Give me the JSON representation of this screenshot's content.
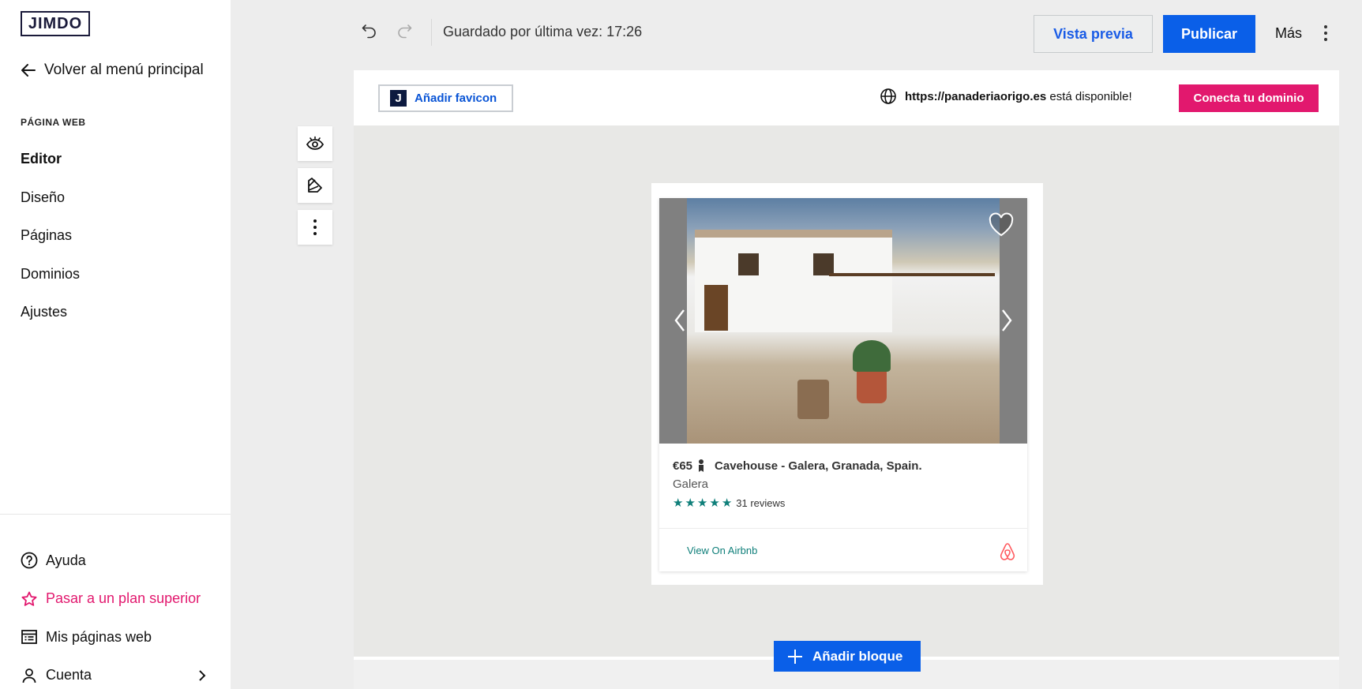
{
  "brand": {
    "logo_text": "JIMDO"
  },
  "sidebar": {
    "back_label": "Volver al menú principal",
    "section_label": "PÁGINA WEB",
    "items": [
      {
        "label": "Editor",
        "active": true
      },
      {
        "label": "Diseño"
      },
      {
        "label": "Páginas"
      },
      {
        "label": "Dominios"
      },
      {
        "label": "Ajustes"
      }
    ],
    "bottom": {
      "help": "Ayuda",
      "upgrade": "Pasar a un plan superior",
      "my_sites": "Mis páginas web",
      "account": "Cuenta"
    }
  },
  "toolbar": {
    "saved_text": "Guardado por última vez: 17:26",
    "preview_label": "Vista previa",
    "publish_label": "Publicar",
    "more_label": "Más"
  },
  "site_header": {
    "favicon_letter": "J",
    "favicon_label": "Añadir favicon",
    "domain_url": "https://panaderiaorigo.es",
    "domain_suffix": " está disponible!",
    "connect_label": "Conecta tu dominio"
  },
  "listing": {
    "price": "€65",
    "title": "Cavehouse - Galera, Granada, Spain.",
    "location": "Galera",
    "stars": 5,
    "reviews": "31 reviews",
    "view_link": "View On Airbnb"
  },
  "add_block_label": "Añadir bloque",
  "colors": {
    "accent_blue": "#0a5fe8",
    "brand_pink": "#e2186e",
    "airbnb_teal": "#0f7f7a",
    "airbnb_red": "#ff5a5f"
  }
}
